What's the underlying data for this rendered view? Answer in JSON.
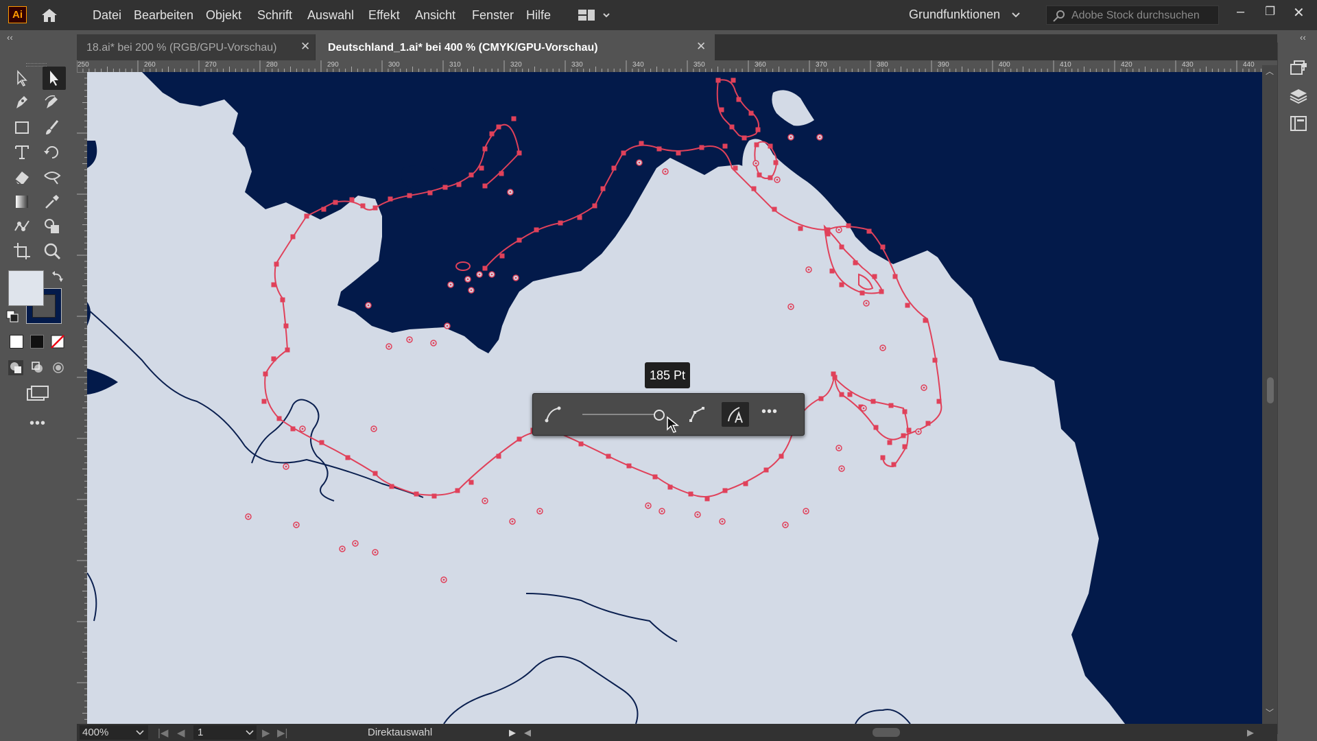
{
  "app": {
    "logo_text": "Ai"
  },
  "menu": [
    "Datei",
    "Bearbeiten",
    "Objekt",
    "Schrift",
    "Auswahl",
    "Effekt",
    "Ansicht",
    "Fenster",
    "Hilfe"
  ],
  "workspace": {
    "label": "Grundfunktionen"
  },
  "search": {
    "placeholder": "Adobe Stock durchsuchen"
  },
  "tabs": [
    {
      "label": "18.ai* bei 200 % (RGB/GPU-Vorschau)",
      "active": false
    },
    {
      "label": "Deutschland_1.ai* bei 400 % (CMYK/GPU-Vorschau)",
      "active": true
    }
  ],
  "ruler": {
    "top_labels": [
      "250",
      "260",
      "270",
      "280",
      "290",
      "300",
      "310",
      "320",
      "330",
      "340",
      "350",
      "360",
      "370",
      "380",
      "390",
      "400",
      "410",
      "420",
      "430",
      "440"
    ]
  },
  "tooltip": {
    "text": "185 Pt"
  },
  "status": {
    "zoom": "400%",
    "artboard": "1",
    "tool": "Direktauswahl"
  },
  "colors": {
    "sea": "#031a4a",
    "land": "#d3dae6",
    "path": "#e0415a",
    "ui_dark": "#323232",
    "ui_mid": "#535353"
  },
  "icons": {
    "toolbar": [
      "selection-tool-icon",
      "direct-selection-tool-icon",
      "pen-tool-icon",
      "curvature-tool-icon",
      "rectangle-tool-icon",
      "paintbrush-tool-icon",
      "type-tool-icon",
      "rotate-tool-icon",
      "eraser-tool-icon",
      "width-tool-icon",
      "gradient-tool-icon",
      "eyedropper-tool-icon",
      "puppet-warp-tool-icon",
      "shape-builder-tool-icon",
      "artboard-tool-icon",
      "zoom-tool-icon"
    ],
    "context": [
      "smooth-curve-icon",
      "corner-point-icon",
      "auto-label-icon",
      "more-icon"
    ],
    "right_panel": [
      "libraries-icon",
      "layers-icon",
      "properties-icon"
    ]
  }
}
